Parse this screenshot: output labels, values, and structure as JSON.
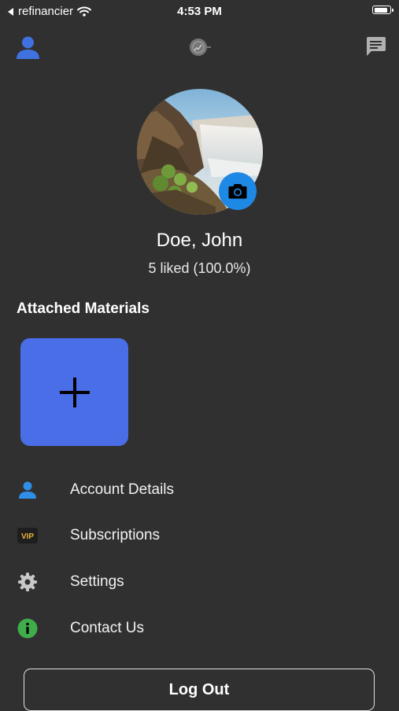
{
  "status_bar": {
    "back_app": "refinancier",
    "time": "4:53 PM",
    "battery_level": 0.9,
    "icons": [
      "back-arrow-icon",
      "wifi-icon",
      "battery-icon"
    ]
  },
  "nav": {
    "icons": [
      "profile-icon",
      "radar-logo-icon",
      "chat-icon"
    ]
  },
  "profile": {
    "name": "Doe, John",
    "liked_stats": "5 liked (100.0%)",
    "photo": "waterfall landscape avatar",
    "camera_icon": "camera-icon"
  },
  "attached_materials": {
    "title": "Attached Materials",
    "add_icon": "plus-icon"
  },
  "menu": [
    {
      "label": "Account Details",
      "icon": "person-icon"
    },
    {
      "label": "Subscriptions",
      "icon": "vip-icon",
      "icon_text": "VIP"
    },
    {
      "label": "Settings",
      "icon": "gear-icon"
    },
    {
      "label": "Contact Us",
      "icon": "info-icon"
    }
  ],
  "logout_label": "Log Out",
  "colors": {
    "background": "#303030",
    "accent_blue": "#1e88e5",
    "add_tile": "#4a6ee8",
    "profile_icon": "#3f72e0",
    "info_green": "#3fae4a",
    "vip_gold": "#e8b23a"
  }
}
